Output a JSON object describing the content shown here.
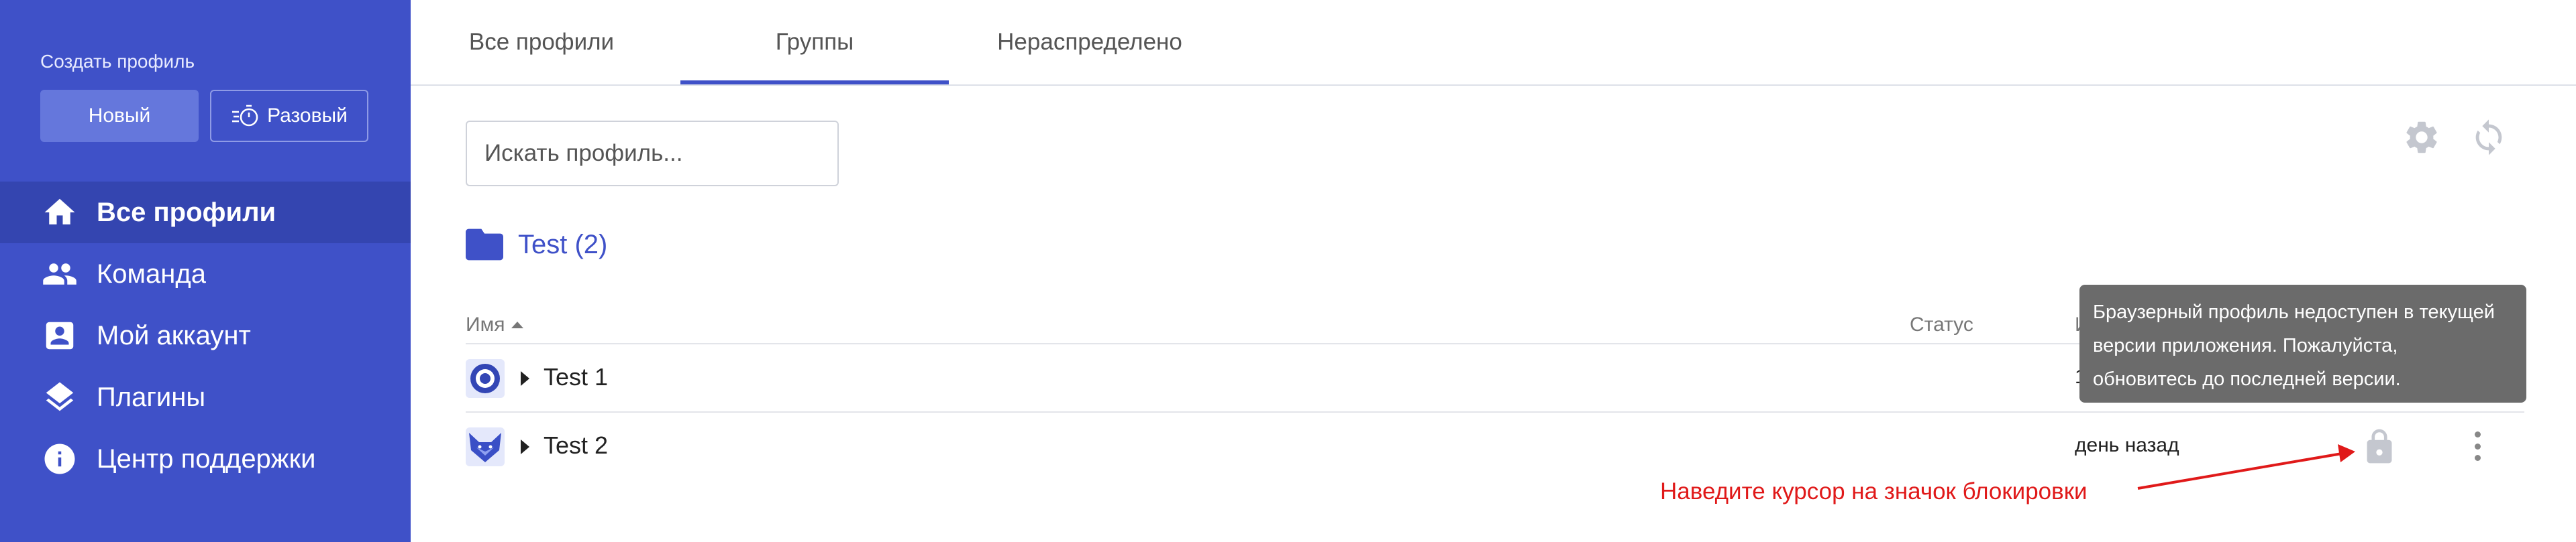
{
  "sidebar": {
    "create_label": "Создать профиль",
    "new_button": "Новый",
    "once_button": "Разовый",
    "items": [
      {
        "label": "Все профили",
        "icon": "home-icon",
        "active": true
      },
      {
        "label": "Команда",
        "icon": "people-icon",
        "active": false
      },
      {
        "label": "Мой аккаунт",
        "icon": "account-box-icon",
        "active": false
      },
      {
        "label": "Плагины",
        "icon": "layers-icon",
        "active": false
      },
      {
        "label": "Центр поддержки",
        "icon": "info-icon",
        "active": false
      }
    ]
  },
  "tabs": [
    {
      "label": "Все профили",
      "active": false
    },
    {
      "label": "Группы",
      "active": true
    },
    {
      "label": "Нераспределено",
      "active": false
    }
  ],
  "search": {
    "placeholder": "Искать профиль..."
  },
  "group": {
    "title": "Test (2)"
  },
  "table": {
    "columns": {
      "name": "Имя",
      "status": "Статус",
      "date": "И"
    },
    "rows": [
      {
        "name": "Test 1",
        "date": "1",
        "avatar": "orbita-icon"
      },
      {
        "name": "Test 2",
        "date": "день назад",
        "avatar": "fox-icon"
      }
    ]
  },
  "tooltip": {
    "lines": [
      "Браузерный профиль недоступен в текущей",
      "версии приложения. Пожалуйста,",
      "обновитесь до последней версии."
    ]
  },
  "annotation": {
    "text": "Наведите курсор на значок блокировки"
  },
  "colors": {
    "primary": "#3f51c8",
    "sidebar_active": "#3445b0",
    "annotation": "#e01919",
    "tooltip_bg": "#6b6b6b",
    "muted_icon": "#c4c7cf"
  }
}
